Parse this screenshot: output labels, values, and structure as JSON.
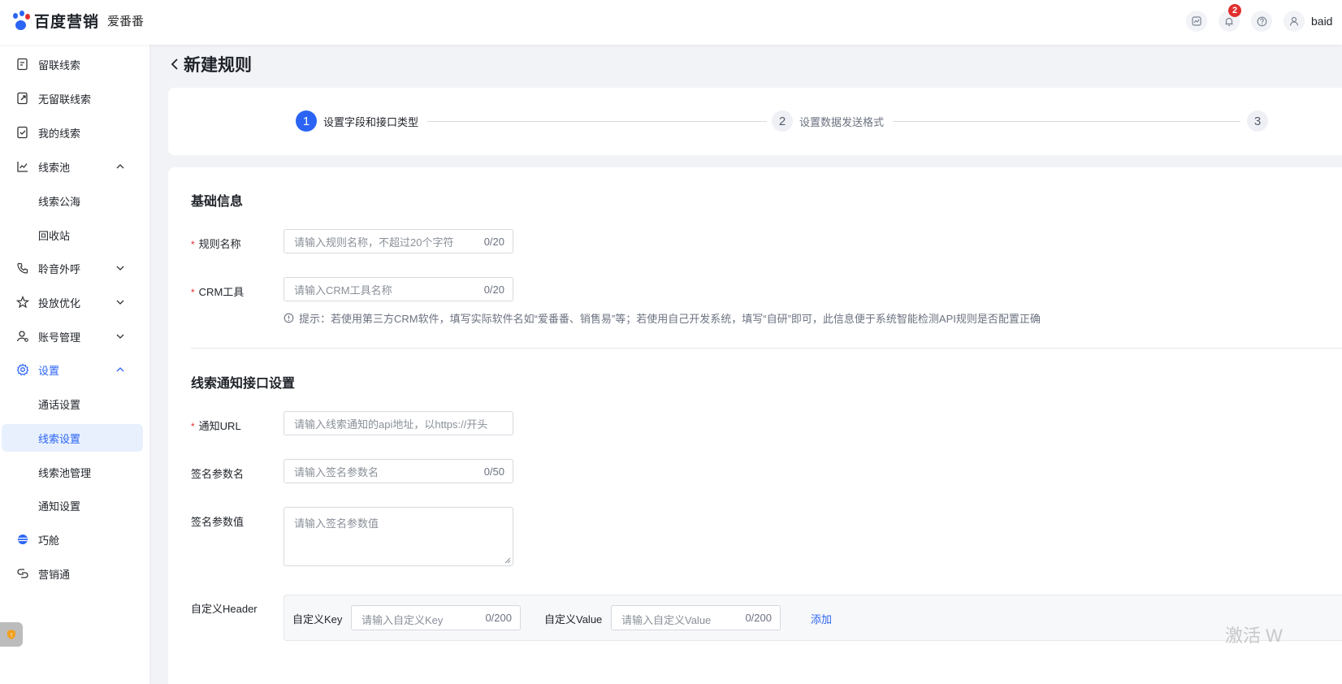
{
  "header": {
    "brand": "百度营销",
    "sub_brand": "爱番番",
    "notification_count": "2",
    "username": "baid",
    "icons": [
      "chart-icon",
      "bell-icon",
      "help-icon",
      "user-icon"
    ]
  },
  "sidebar": {
    "items": [
      {
        "label": "留联线索",
        "icon": "lead-icon"
      },
      {
        "label": "无留联线索",
        "icon": "lead-export-icon"
      },
      {
        "label": "我的线索",
        "icon": "my-lead-icon"
      },
      {
        "label": "线索池",
        "icon": "chart-line-icon",
        "expanded": true
      },
      {
        "label": "线索公海"
      },
      {
        "label": "回收站"
      },
      {
        "label": "聆音外呼",
        "icon": "phone-icon",
        "expanded": false
      },
      {
        "label": "投放优化",
        "icon": "optimize-icon",
        "expanded": false
      },
      {
        "label": "账号管理",
        "icon": "account-icon",
        "expanded": false
      },
      {
        "label": "设置",
        "icon": "gear-icon",
        "expanded": true
      },
      {
        "label": "通话设置"
      },
      {
        "label": "线索设置",
        "active": true
      },
      {
        "label": "线索池管理"
      },
      {
        "label": "通知设置"
      },
      {
        "label": "巧舱",
        "icon": "planet-icon"
      },
      {
        "label": "营销通",
        "icon": "link-icon"
      }
    ],
    "accent": "#2b64f5"
  },
  "page": {
    "title": "新建规则"
  },
  "steps": [
    {
      "num": "1",
      "label": "设置字段和接口类型",
      "active": true
    },
    {
      "num": "2",
      "label": "设置数据发送格式",
      "active": false
    },
    {
      "num": "3",
      "label": "",
      "active": false
    }
  ],
  "form": {
    "basic_title": "基础信息",
    "rule_name": {
      "label": "规则名称",
      "placeholder": "请输入规则名称，不超过20个字符",
      "count": "0/20"
    },
    "crm_tool": {
      "label": "CRM工具",
      "placeholder": "请输入CRM工具名称",
      "count": "0/20"
    },
    "tip": "提示：若使用第三方CRM软件，填写实际软件名如“爱番番、销售易”等；若使用自己开发系统，填写“自研”即可，此信息便于系统智能检测API规则是否配置正确",
    "notify_title": "线索通知接口设置",
    "notify_url": {
      "label": "通知URL",
      "placeholder": "请输入线索通知的api地址，以https://开头"
    },
    "sign_name": {
      "label": "签名参数名",
      "placeholder": "请输入签名参数名",
      "count": "0/50"
    },
    "sign_value": {
      "label": "签名参数值",
      "placeholder": "请输入签名参数值"
    },
    "custom_header": {
      "label": "自定义Header",
      "key_label": "自定义Key",
      "key_placeholder": "请输入自定义Key",
      "key_count": "0/200",
      "value_label": "自定义Value",
      "value_placeholder": "请输入自定义Value",
      "value_count": "0/200",
      "add": "添加"
    }
  },
  "watermark": "激活 W"
}
